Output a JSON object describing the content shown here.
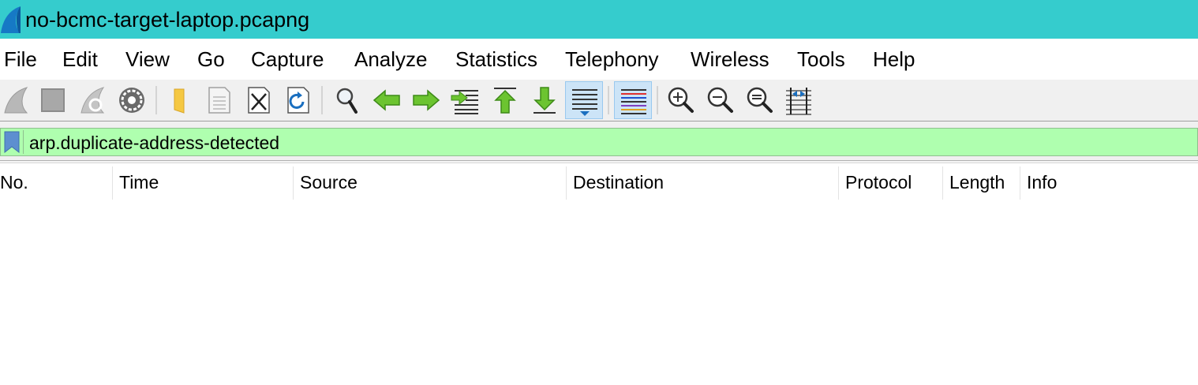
{
  "window": {
    "title": "no-bcmc-target-laptop.pcapng"
  },
  "menu": [
    "File",
    "Edit",
    "View",
    "Go",
    "Capture",
    "Analyze",
    "Statistics",
    "Telephony",
    "Wireless",
    "Tools",
    "Help"
  ],
  "toolbar": {
    "buttons": [
      "start-capture-icon",
      "stop-capture-icon",
      "restart-capture-icon",
      "capture-options-icon",
      "open-file-icon",
      "save-file-icon",
      "close-file-icon",
      "reload-file-icon",
      "find-packet-icon",
      "go-back-icon",
      "go-forward-icon",
      "go-to-packet-icon",
      "go-to-first-packet-icon",
      "go-to-last-packet-icon",
      "auto-scroll-icon",
      "colorize-icon",
      "zoom-in-icon",
      "zoom-out-icon",
      "normal-size-icon",
      "resize-columns-icon"
    ],
    "checked": [
      "auto-scroll-icon",
      "colorize-icon"
    ]
  },
  "filter": {
    "value": "arp.duplicate-address-detected",
    "valid_color": "#afffaf"
  },
  "packet_list": {
    "columns": [
      "No.",
      "Time",
      "Source",
      "Destination",
      "Protocol",
      "Length",
      "Info"
    ],
    "rows": []
  },
  "colors": {
    "titlebar": "#35cccd",
    "toolbar_bg": "#f0f0f0",
    "checked_button": "#cce4f7"
  }
}
